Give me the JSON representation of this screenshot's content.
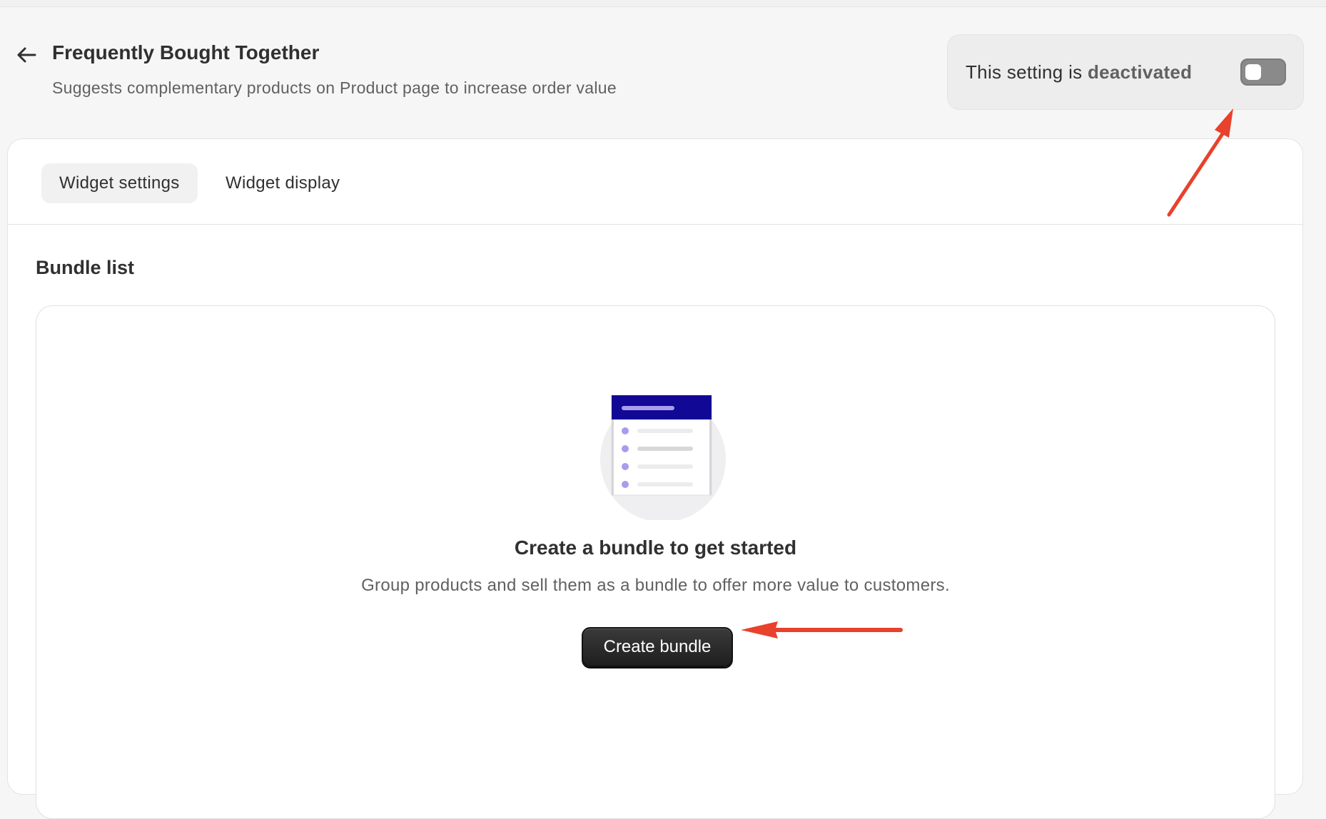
{
  "header": {
    "back_label": "Back",
    "title": "Frequently Bought Together",
    "subtitle": "Suggests complementary products on Product page to increase order value"
  },
  "status": {
    "prefix": "This setting is",
    "state": "deactivated",
    "enabled": false
  },
  "tabs": [
    {
      "label": "Widget settings",
      "active": true
    },
    {
      "label": "Widget display",
      "active": false
    }
  ],
  "bundle_list": {
    "title": "Bundle list",
    "empty_state": {
      "heading": "Create a bundle to get started",
      "description": "Group products and sell them as a bundle to offer more value to customers.",
      "button_label": "Create bundle"
    }
  },
  "colors": {
    "annotation_arrow": "#e8412c",
    "illustration_header": "#120896",
    "illustration_bullet": "#a99cec"
  },
  "icons": {
    "back": "arrow-left-icon",
    "empty_state": "document-list-illustration"
  }
}
